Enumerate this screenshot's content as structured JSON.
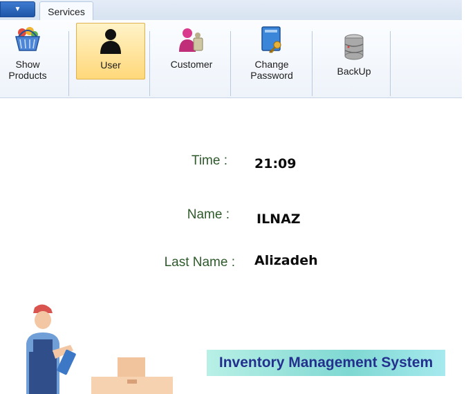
{
  "ribbon": {
    "app_menu_icon": "caret-down-icon",
    "tab_label": "Services",
    "buttons": [
      {
        "label": "Show\nProducts",
        "icon": "shopping-basket-icon"
      },
      {
        "label": "User",
        "icon": "user-silhouette-icon",
        "selected": true
      },
      {
        "label": "Customer",
        "icon": "customers-icon"
      },
      {
        "label": "Change\nPassword",
        "icon": "book-key-icon"
      },
      {
        "label": "BackUp",
        "icon": "database-icon"
      }
    ]
  },
  "info": {
    "time_label": "Time :",
    "time_value": "21:09",
    "name_label": "Name :",
    "name_value": "ILNAZ",
    "last_name_label": "Last Name :",
    "last_name_value": "Alizadeh"
  },
  "banner": {
    "text": "Inventory Management System"
  },
  "illustration": {
    "icon": "warehouse-worker-icon"
  }
}
